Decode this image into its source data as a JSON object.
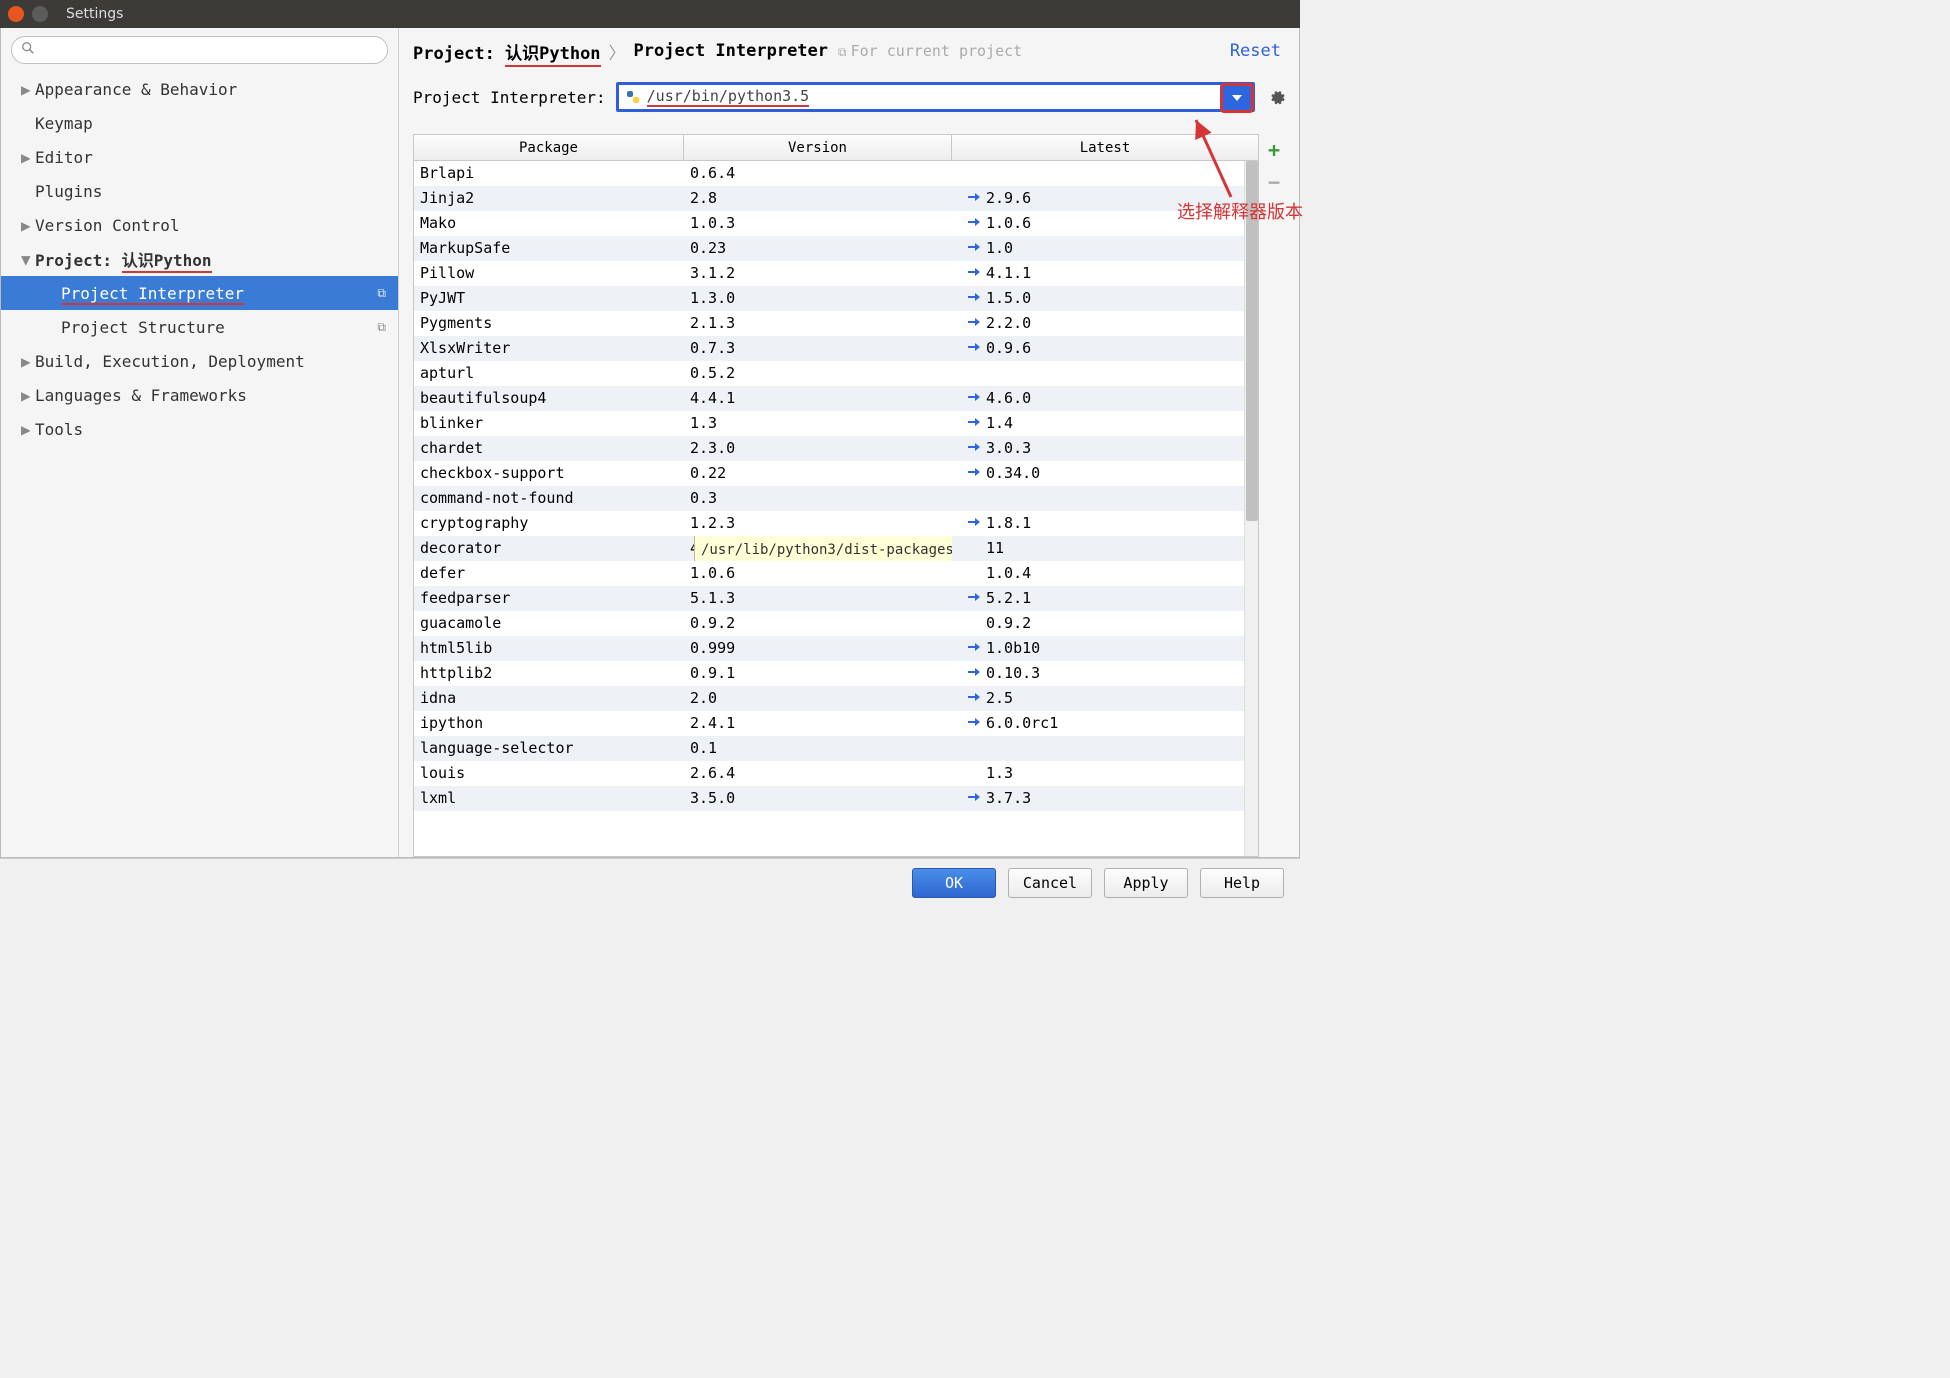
{
  "window": {
    "title": "Settings"
  },
  "sidebar": {
    "items": [
      {
        "label": "Appearance & Behavior",
        "expandable": true
      },
      {
        "label": "Keymap",
        "expandable": false
      },
      {
        "label": "Editor",
        "expandable": true
      },
      {
        "label": "Plugins",
        "expandable": false
      },
      {
        "label": "Version Control",
        "expandable": true
      },
      {
        "label": "Project: 认识Python",
        "expandable": true,
        "expanded": true,
        "bold": true,
        "underlined_part": "认识Python"
      },
      {
        "label": "Project Interpreter",
        "selected": true,
        "child": true,
        "copy_icon": true,
        "underlined_part": "Project Interpreter"
      },
      {
        "label": "Project Structure",
        "child": true,
        "copy_icon": true
      },
      {
        "label": "Build, Execution, Deployment",
        "expandable": true
      },
      {
        "label": "Languages & Frameworks",
        "expandable": true
      },
      {
        "label": "Tools",
        "expandable": true
      }
    ]
  },
  "breadcrumb": {
    "project_prefix": "Project: ",
    "project_name": "认识Python",
    "page": "Project Interpreter",
    "context": "For current project",
    "reset": "Reset"
  },
  "interpreter": {
    "label": "Project Interpreter:",
    "path": "/usr/bin/python3.5"
  },
  "table": {
    "headers": {
      "package": "Package",
      "version": "Version",
      "latest": "Latest"
    },
    "rows": [
      {
        "pkg": "Brlapi",
        "ver": "0.6.4",
        "latest": "",
        "up": false
      },
      {
        "pkg": "Jinja2",
        "ver": "2.8",
        "latest": "2.9.6",
        "up": true
      },
      {
        "pkg": "Mako",
        "ver": "1.0.3",
        "latest": "1.0.6",
        "up": true
      },
      {
        "pkg": "MarkupSafe",
        "ver": "0.23",
        "latest": "1.0",
        "up": true
      },
      {
        "pkg": "Pillow",
        "ver": "3.1.2",
        "latest": "4.1.1",
        "up": true
      },
      {
        "pkg": "PyJWT",
        "ver": "1.3.0",
        "latest": "1.5.0",
        "up": true
      },
      {
        "pkg": "Pygments",
        "ver": "2.1.3",
        "latest": "2.2.0",
        "up": true
      },
      {
        "pkg": "XlsxWriter",
        "ver": "0.7.3",
        "latest": "0.9.6",
        "up": true
      },
      {
        "pkg": "apturl",
        "ver": "0.5.2",
        "latest": "",
        "up": false
      },
      {
        "pkg": "beautifulsoup4",
        "ver": "4.4.1",
        "latest": "4.6.0",
        "up": true
      },
      {
        "pkg": "blinker",
        "ver": "1.3",
        "latest": "1.4",
        "up": true
      },
      {
        "pkg": "chardet",
        "ver": "2.3.0",
        "latest": "3.0.3",
        "up": true
      },
      {
        "pkg": "checkbox-support",
        "ver": "0.22",
        "latest": "0.34.0",
        "up": true
      },
      {
        "pkg": "command-not-found",
        "ver": "0.3",
        "latest": "",
        "up": false
      },
      {
        "pkg": "cryptography",
        "ver": "1.2.3",
        "latest": "1.8.1",
        "up": true
      },
      {
        "pkg": "decorator",
        "ver": "4",
        "latest": "11",
        "up": false,
        "tooltip": "/usr/lib/python3/dist-packages"
      },
      {
        "pkg": "defer",
        "ver": "1.0.6",
        "latest": "1.0.4",
        "up": false
      },
      {
        "pkg": "feedparser",
        "ver": "5.1.3",
        "latest": "5.2.1",
        "up": true
      },
      {
        "pkg": "guacamole",
        "ver": "0.9.2",
        "latest": "0.9.2",
        "up": false
      },
      {
        "pkg": "html5lib",
        "ver": "0.999",
        "latest": "1.0b10",
        "up": true
      },
      {
        "pkg": "httplib2",
        "ver": "0.9.1",
        "latest": "0.10.3",
        "up": true
      },
      {
        "pkg": "idna",
        "ver": "2.0",
        "latest": "2.5",
        "up": true
      },
      {
        "pkg": "ipython",
        "ver": "2.4.1",
        "latest": "6.0.0rc1",
        "up": true
      },
      {
        "pkg": "language-selector",
        "ver": "0.1",
        "latest": "",
        "up": false
      },
      {
        "pkg": "louis",
        "ver": "2.6.4",
        "latest": "1.3",
        "up": false
      },
      {
        "pkg": "lxml",
        "ver": "3.5.0",
        "latest": "3.7.3",
        "up": true
      }
    ]
  },
  "annotation": {
    "text": "选择解释器版本"
  },
  "footer": {
    "ok": "OK",
    "cancel": "Cancel",
    "apply": "Apply",
    "help": "Help"
  }
}
